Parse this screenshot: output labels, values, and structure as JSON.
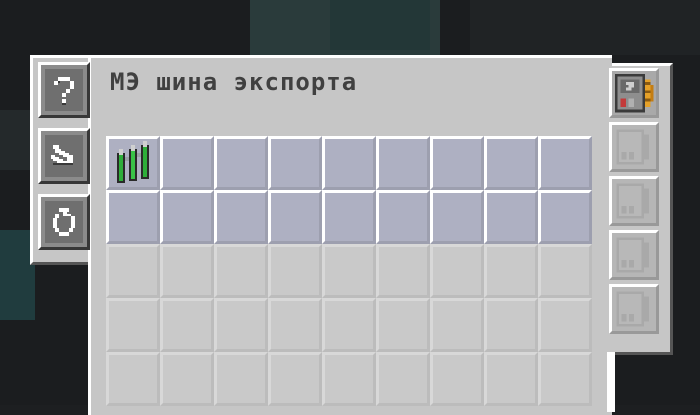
{
  "window": {
    "title": "МЭ шина экспорта"
  },
  "tabs": [
    {
      "name": "help",
      "icon": "question-mark-icon",
      "glyph": "?"
    },
    {
      "name": "redstone-mode",
      "icon": "redstone-mode-icon"
    },
    {
      "name": "scheduling-mode",
      "icon": "cycle-icon"
    }
  ],
  "config_grid": {
    "columns": 9,
    "rows": 5,
    "active_rows": 2,
    "items": [
      {
        "slot": 0,
        "icon": "green-tubes-item-icon"
      }
    ]
  },
  "upgrade_slots": [
    {
      "icon": "capacity-card-icon",
      "filled": true
    },
    {
      "icon": "empty-card-slot-icon",
      "filled": false
    },
    {
      "icon": "empty-card-slot-icon",
      "filled": false
    },
    {
      "icon": "empty-card-slot-icon",
      "filled": false
    },
    {
      "icon": "empty-card-slot-icon",
      "filled": false
    }
  ],
  "colors": {
    "panel": "#c6c6c6",
    "active_slot": "#aeb0c2",
    "inactive_slot": "#c9c9c9",
    "button": "#8b8b8b",
    "text": "#404040"
  }
}
